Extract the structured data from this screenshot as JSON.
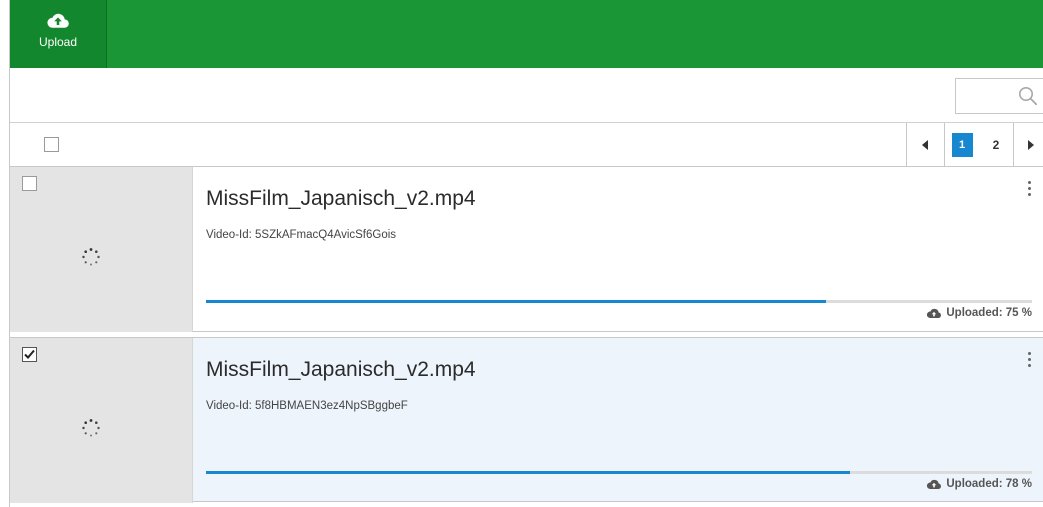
{
  "toolbar": {
    "upload_label": "Upload",
    "upload_icon": "cloud-upload-icon",
    "background_color": "#1a9637"
  },
  "search": {
    "placeholder": "",
    "icon": "search-icon"
  },
  "pagination": {
    "prev_icon": "chevron-left-icon",
    "pages": [
      "1",
      "2"
    ],
    "current_page": "1",
    "next_icon": "chevron-right-icon",
    "active_color": "#1788d0"
  },
  "videos": [
    {
      "title": "MissFilm_Japanisch_v2.mp4",
      "video_id": "Video-Id: 5SZkAFmacQ4AvicSf6Gois",
      "status": "Uploaded: 75 %",
      "progress_percent": 75,
      "selected": false
    },
    {
      "title": "MissFilm_Japanisch_v2.mp4",
      "video_id": "Video-Id: 5f8HBMAEN3ez4NpSBggbeF",
      "status": "Uploaded: 78 %",
      "progress_percent": 78,
      "selected": true
    }
  ]
}
